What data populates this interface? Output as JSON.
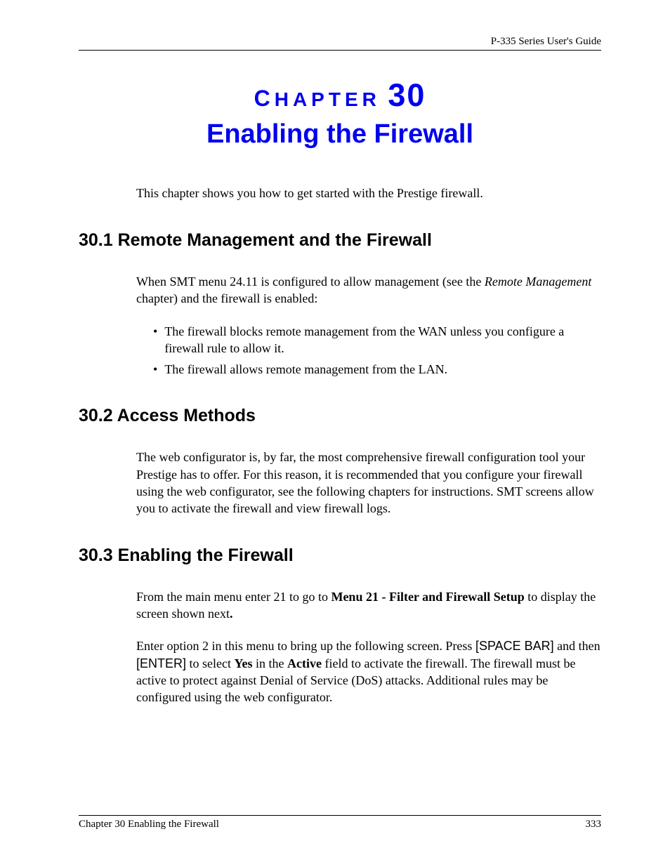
{
  "header": {
    "guide": "P-335 Series User's Guide"
  },
  "chapter": {
    "label_prefix": "C",
    "label_rest": "HAPTER",
    "number": "30",
    "title": "Enabling the Firewall"
  },
  "intro": "This chapter shows you how to get started with the Prestige firewall.",
  "sections": {
    "s1": {
      "heading": "30.1  Remote Management and the Firewall",
      "p1_a": "When SMT menu 24.11 is configured to allow management (see the ",
      "p1_italic": "Remote Management",
      "p1_b": " chapter) and the firewall is enabled:",
      "bullets": [
        "The firewall blocks remote management from the WAN unless you configure a firewall rule to allow it.",
        "The firewall allows remote management from the LAN."
      ]
    },
    "s2": {
      "heading": "30.2  Access Methods",
      "p1": "The web configurator is, by far, the most comprehensive firewall configuration tool your Prestige has to offer. For this reason, it is recommended that you configure your firewall using the web configurator, see the following chapters for instructions. SMT screens allow you to activate the firewall and view firewall logs."
    },
    "s3": {
      "heading": "30.3  Enabling the Firewall",
      "p1_a": "From the main menu enter 21 to go to ",
      "p1_bold": "Menu 21 - Filter and Firewall Setup",
      "p1_b": " to display the screen shown next",
      "p1_c": ".",
      "p2_a": "Enter option 2 in this menu to bring up the following screen. Press ",
      "p2_sans1": "[SPACE BAR]",
      "p2_b": " and then ",
      "p2_sans2": "[ENTER]",
      "p2_c": " to select ",
      "p2_bold1": "Yes",
      "p2_d": " in the ",
      "p2_bold2": "Active",
      "p2_e": " field to activate the firewall. The firewall must be active to protect against Denial of Service (DoS) attacks. Additional rules may be configured using the web configurator."
    }
  },
  "footer": {
    "left": "Chapter 30 Enabling the Firewall",
    "right": "333"
  }
}
